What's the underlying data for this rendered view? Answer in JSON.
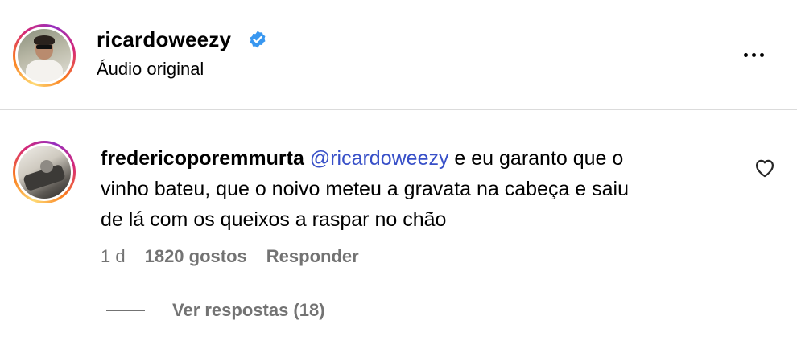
{
  "header": {
    "username": "ricardoweezy",
    "subtitle": "Áudio original",
    "verified_color": "#3897f0"
  },
  "comment": {
    "username": "fredericoporemmurta",
    "mention": "@ricardoweezy",
    "text_line1": " e eu garanto que o",
    "text_line2": "vinho bateu, que o noivo meteu a gravata na cabeça e saiu",
    "text_line3": "de lá com os queixos a raspar no chão",
    "time": "1 d",
    "likes": "1820 gostos",
    "reply_label": "Responder",
    "view_replies": "Ver respostas (18)"
  },
  "icons": [
    "verified-badge-icon",
    "more-options-icon",
    "heart-icon"
  ]
}
